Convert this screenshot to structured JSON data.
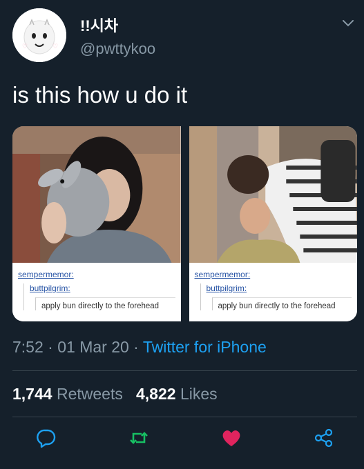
{
  "user": {
    "display_name": "!!시차",
    "handle": "@pwttykoo"
  },
  "tweet": {
    "text": "is this how u do it"
  },
  "media": [
    {
      "user1": "sempermemor:",
      "user2": "buttpilgrim:",
      "quote": "apply bun directly to the forehead"
    },
    {
      "user1": "sempermemor:",
      "user2": "buttpilgrim:",
      "quote": "apply bun directly to the forehead"
    }
  ],
  "meta": {
    "time": "7:52",
    "sep1": " · ",
    "date": "01 Mar 20",
    "sep2": " · ",
    "source": "Twitter for iPhone"
  },
  "stats": {
    "retweets_count": "1,744",
    "retweets_label": "Retweets",
    "likes_count": "4,822",
    "likes_label": "Likes"
  },
  "colors": {
    "background": "#15202b",
    "accent": "#1da1f2",
    "retweet": "#17bf63",
    "like": "#e0245e",
    "secondary_text": "#8899a6"
  },
  "icons": [
    "chevron-down-icon",
    "reply-icon",
    "retweet-icon",
    "like-icon",
    "share-icon"
  ]
}
